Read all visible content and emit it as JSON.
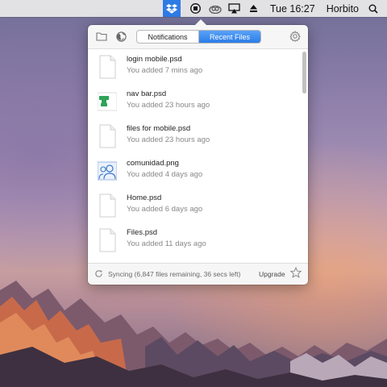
{
  "menubar": {
    "icons": [
      "dropbox-icon",
      "record-icon",
      "creative-cloud-icon",
      "airplay-icon",
      "eject-icon"
    ],
    "clock": "Tue 16:27",
    "user": "Horbito",
    "search_icon": "search-icon"
  },
  "popover": {
    "header": {
      "folder_icon": "folder-icon",
      "globe_icon": "globe-icon",
      "tabs": [
        {
          "label": "Notifications",
          "active": false
        },
        {
          "label": "Recent Files",
          "active": true
        }
      ],
      "settings_icon": "gear-icon"
    },
    "files": [
      {
        "name": "login mobile.psd",
        "meta": "You added 7 mins ago",
        "thumb": "document"
      },
      {
        "name": "nav bar.psd",
        "meta": "You added 23 hours ago",
        "thumb": "green-image"
      },
      {
        "name": "files for mobile.psd",
        "meta": "You added 23 hours ago",
        "thumb": "document"
      },
      {
        "name": "comunidad.png",
        "meta": "You added 4 days ago",
        "thumb": "people-image"
      },
      {
        "name": "Home.psd",
        "meta": "You added 6 days ago",
        "thumb": "document"
      },
      {
        "name": "Files.psd",
        "meta": "You added 11 days ago",
        "thumb": "document"
      }
    ],
    "footer": {
      "status": "Syncing (6,847 files remaining, 36 secs left)",
      "upgrade": "Upgrade",
      "star_icon": "star-icon"
    }
  },
  "colors": {
    "accent": "#2b7ce9",
    "menubar_highlight": "#2f7be6"
  }
}
